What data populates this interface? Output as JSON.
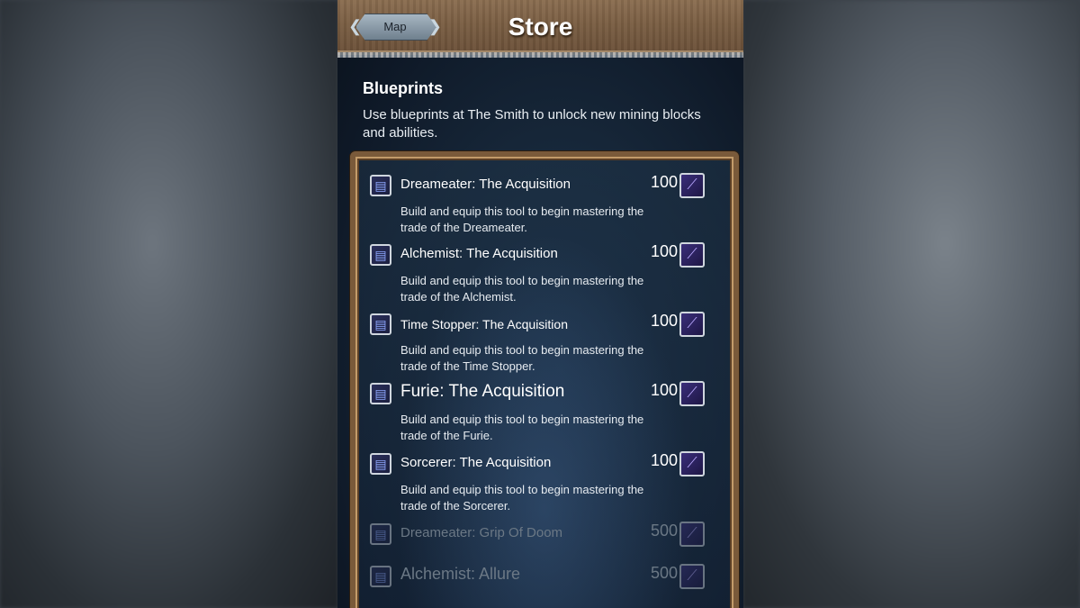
{
  "header": {
    "title": "Store",
    "map_label": "Map"
  },
  "section": {
    "title": "Blueprints",
    "description": "Use blueprints at The Smith to unlock new mining blocks and abilities."
  },
  "items": [
    {
      "name": "Dreameater: The Acquisition",
      "price": "100",
      "description": "Build and equip this tool to begin mastering the trade of the Dreameater.",
      "locked": false
    },
    {
      "name": "Alchemist: The Acquisition",
      "price": "100",
      "description": "Build and equip this tool to begin mastering the trade of the Alchemist.",
      "locked": false
    },
    {
      "name": "Time Stopper: The Acquisition",
      "price": "100",
      "description": "Build and equip this tool to begin mastering the trade of the Time Stopper.",
      "locked": false
    },
    {
      "name": "Furie: The Acquisition",
      "price": "100",
      "description": "Build and equip this tool to begin mastering the trade of the Furie.",
      "locked": false
    },
    {
      "name": "Sorcerer: The Acquisition",
      "price": "100",
      "description": "Build and equip this tool to begin mastering the trade of the Sorcerer.",
      "locked": false
    },
    {
      "name": "Dreameater: Grip Of Doom",
      "price": "500",
      "description": "",
      "locked": true
    },
    {
      "name": "Alchemist: Allure",
      "price": "500",
      "description": "",
      "locked": true
    }
  ],
  "icons": {
    "blueprint": "blueprint-scroll-icon",
    "currency": "crystal-icon",
    "map_back": "ornate-arrow-icon"
  },
  "colors": {
    "header_wood": "#7a5e43",
    "panel_frame": "#7a5a3a",
    "text_primary": "#ffffff",
    "text_locked": "#6b7885"
  }
}
